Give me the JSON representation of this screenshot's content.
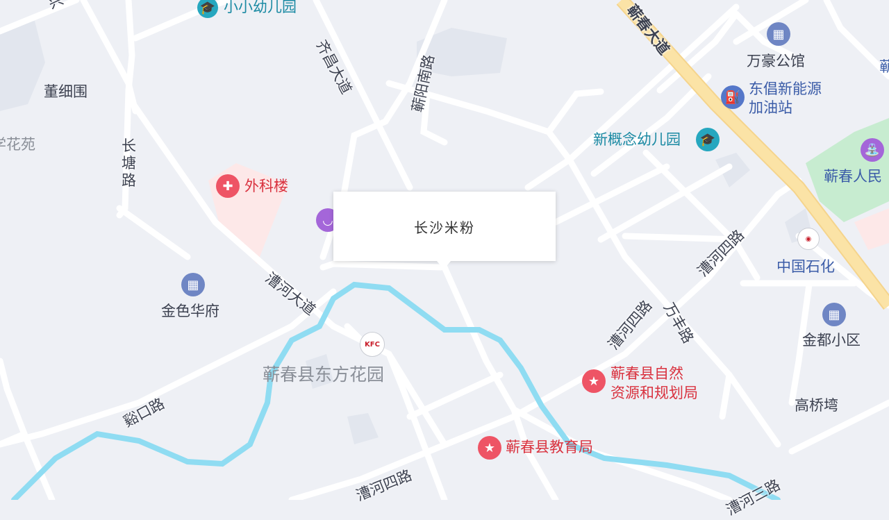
{
  "popup": {
    "title": "长沙米粉"
  },
  "places": {
    "xiaoxiao_kindergarten": "小小幼儿园",
    "dongxiwei": "董细围",
    "huayuan": "学花苑",
    "waikelou": "外科楼",
    "jinsehuafu": "金色华府",
    "dongfang_garden": "蕲春县东方花园",
    "wanhao": "万豪公馆",
    "gas_station_line1": "东倡新能源",
    "gas_station_line2": "加油站",
    "xingainian_kindergarten": "新概念幼儿园",
    "renmin": "蕲春人民",
    "sinopec": "中国石化",
    "jindu": "金都小区",
    "gaoqiaowan": "高桥塆",
    "ziran_line1": "蕲春县自然",
    "ziran_line2": "资源和规划局",
    "education_bureau": "蕲春县教育局"
  },
  "roads": {
    "qichun_avenue": "蕲春大道",
    "qichang_avenue": "齐昌大道",
    "qiyang_south": "蕲阳南路",
    "changtang": "长塘路",
    "caohe_avenue": "漕河大道",
    "caohe4_a": "漕河四路",
    "caohe4_b": "漕河四路",
    "caohe4_c": "漕河四路",
    "wanfeng": "万丰路",
    "xikou": "谿口路",
    "caohe3": "漕河三路",
    "corner_top_left": "兴",
    "corner_right": "蕲"
  },
  "icons": {
    "school": "graduation-cap-icon",
    "residential": "building-icon",
    "hospital": "cross-icon",
    "gas": "fuel-pump-icon",
    "government": "star-icon",
    "kfc": "kfc-logo-icon",
    "sinopec": "sinopec-logo-icon",
    "park": "fountain-icon",
    "shop": "shopping-bag-icon"
  },
  "colors": {
    "background": "#eef0f5",
    "road": "#ffffff",
    "major_road": "#fbe3a6",
    "river": "#8fdcf2",
    "park": "#c7ecd0",
    "hospital_area": "#fde8e8",
    "building": "#e2e6ee"
  }
}
